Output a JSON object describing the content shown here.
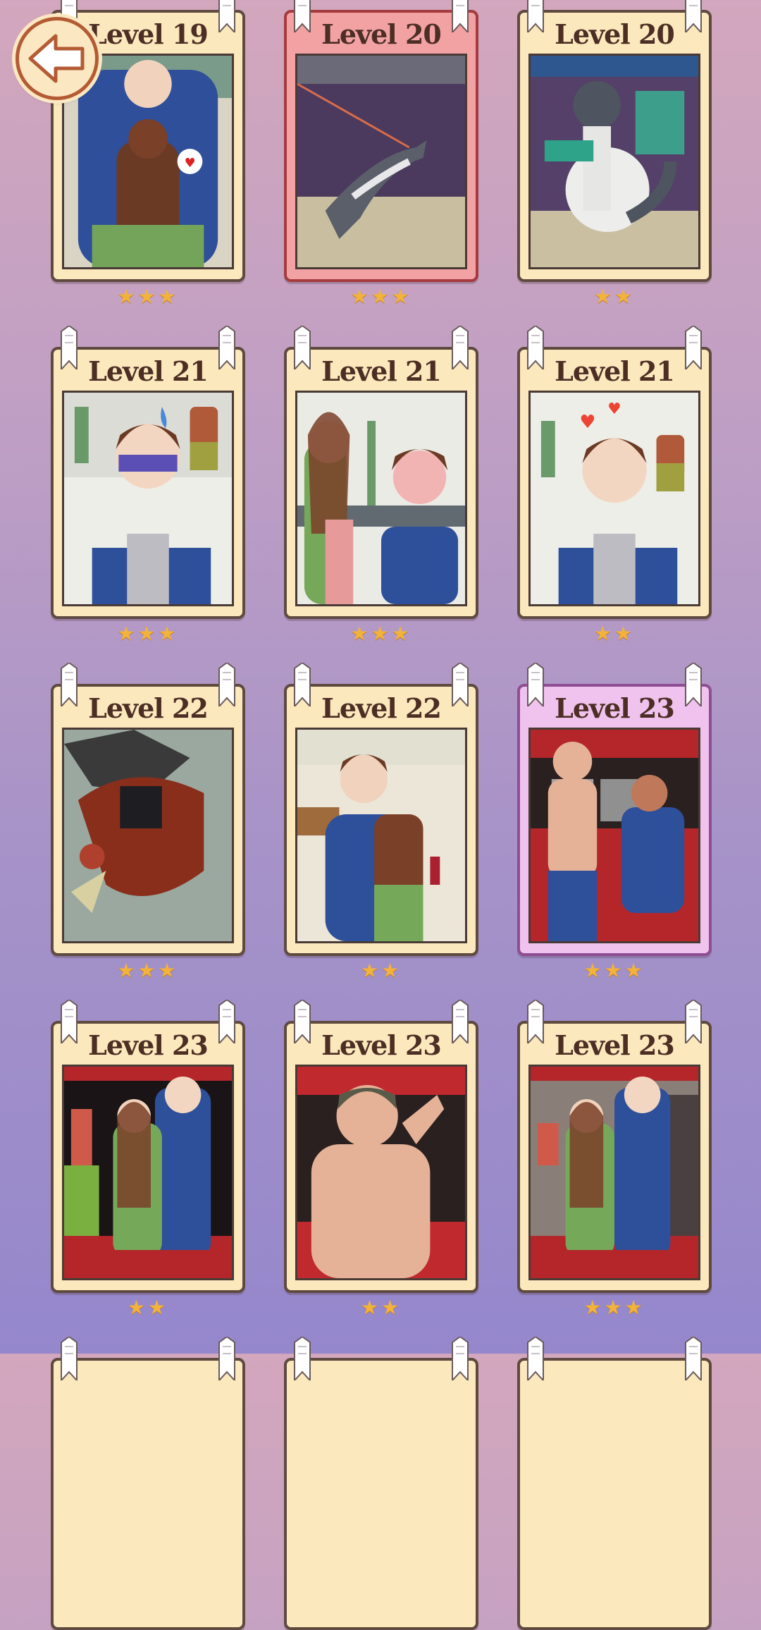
{
  "level_prefix": "Level",
  "cards": [
    {
      "level": "19",
      "stars": 3,
      "scene": "hug-kitchen",
      "state": "normal"
    },
    {
      "level": "20",
      "stars": 3,
      "scene": "wolf-leash",
      "state": "selected"
    },
    {
      "level": "20",
      "stars": 2,
      "scene": "wolf-sit",
      "state": "normal"
    },
    {
      "level": "21",
      "stars": 3,
      "scene": "boy-eating-sick",
      "state": "normal"
    },
    {
      "level": "21",
      "stars": 3,
      "scene": "girl-feeding-boy",
      "state": "normal"
    },
    {
      "level": "21",
      "stars": 2,
      "scene": "boy-eating-happy",
      "state": "normal"
    },
    {
      "level": "22",
      "stars": 3,
      "scene": "caped-villain",
      "state": "normal"
    },
    {
      "level": "22",
      "stars": 2,
      "scene": "embrace-kitchen",
      "state": "normal"
    },
    {
      "level": "23",
      "stars": 3,
      "scene": "shirtless-man-bus",
      "state": "special"
    },
    {
      "level": "23",
      "stars": 2,
      "scene": "couple-bus",
      "state": "normal"
    },
    {
      "level": "23",
      "stars": 2,
      "scene": "shirtless-man-closeup",
      "state": "normal"
    },
    {
      "level": "23",
      "stars": 3,
      "scene": "couple-bus-shadows",
      "state": "normal"
    }
  ],
  "colors": {
    "card_bg": "#fbe8bd",
    "card_selected": "#f3a2a4",
    "card_special": "#f0c3ef",
    "star": "#f3b23a",
    "title_text": "#4c2e24"
  },
  "icons": {
    "back": "back-arrow-icon",
    "star": "star-icon",
    "ribbon": "ribbon-icon"
  }
}
